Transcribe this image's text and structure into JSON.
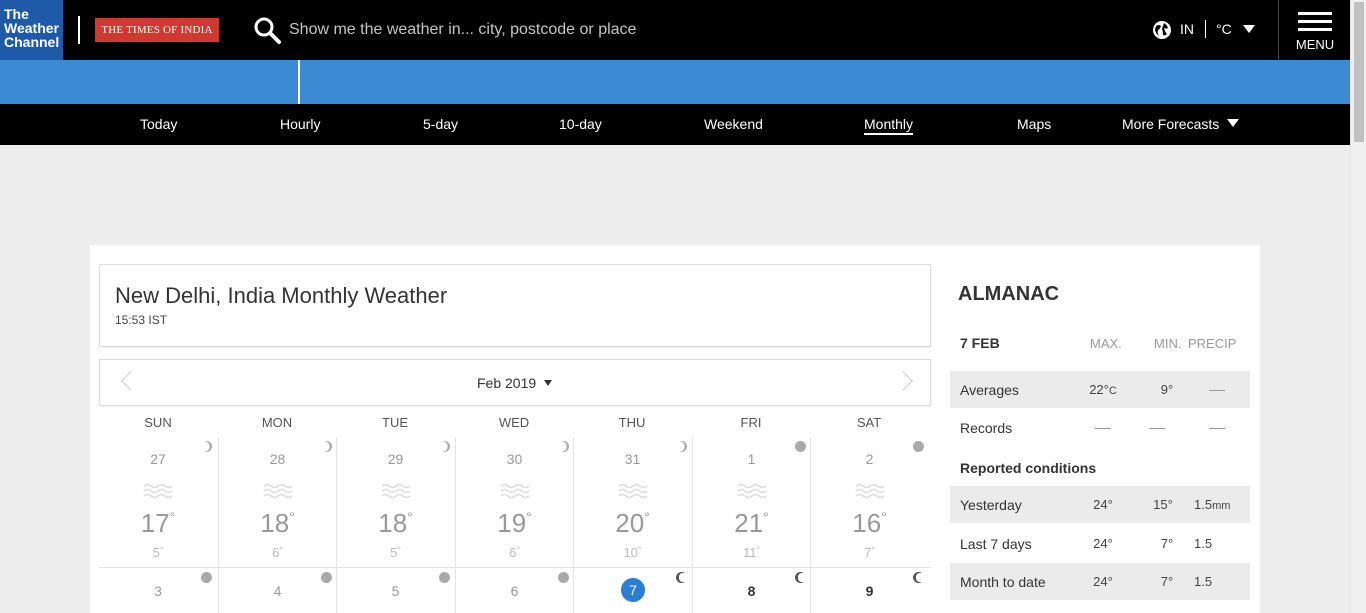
{
  "header": {
    "brand_lines": [
      "The",
      "Weather",
      "Channel"
    ],
    "partner_logo": "THE TIMES OF INDIA",
    "search_placeholder": "Show me the weather in... city, postcode or place",
    "region": "IN",
    "unit": "°C",
    "menu_label": "MENU"
  },
  "nav": {
    "items": [
      "Today",
      "Hourly",
      "5-day",
      "10-day",
      "Weekend",
      "Monthly",
      "Maps",
      "More Forecasts"
    ],
    "active": "Monthly"
  },
  "title": {
    "heading": "New Delhi, India Monthly Weather",
    "time": "15:53 IST"
  },
  "calendar": {
    "month_label": "Feb 2019",
    "weekdays": [
      "SUN",
      "MON",
      "TUE",
      "WED",
      "THU",
      "FRI",
      "SAT"
    ],
    "week1": [
      {
        "date": "27",
        "hi": "17",
        "lo": "5",
        "moon": "waning-crescent"
      },
      {
        "date": "28",
        "hi": "18",
        "lo": "6",
        "moon": "waning-crescent"
      },
      {
        "date": "29",
        "hi": "18",
        "lo": "5",
        "moon": "waning-crescent"
      },
      {
        "date": "30",
        "hi": "19",
        "lo": "6",
        "moon": "waning-crescent"
      },
      {
        "date": "31",
        "hi": "20",
        "lo": "10",
        "moon": "waning-crescent"
      },
      {
        "date": "1",
        "hi": "21",
        "lo": "11",
        "moon": "new"
      },
      {
        "date": "2",
        "hi": "16",
        "lo": "7",
        "moon": "new"
      }
    ],
    "week2": [
      {
        "date": "3",
        "moon": "new"
      },
      {
        "date": "4",
        "moon": "new"
      },
      {
        "date": "5",
        "moon": "new"
      },
      {
        "date": "6",
        "moon": "new"
      },
      {
        "date": "7",
        "moon": "waxing-crescent",
        "today": true
      },
      {
        "date": "8",
        "moon": "waxing-crescent"
      },
      {
        "date": "9",
        "moon": "waxing-crescent"
      }
    ]
  },
  "almanac": {
    "title": "ALMANAC",
    "date": "7 FEB",
    "col_max": "MAX.",
    "col_min": "MIN.",
    "col_precip": "PRECIP",
    "averages": {
      "label": "Averages",
      "max": "22°",
      "max_unit": "C",
      "min": "9°"
    },
    "records": {
      "label": "Records"
    },
    "reported_title": "Reported conditions",
    "yesterday": {
      "label": "Yesterday",
      "max": "24°",
      "min": "15°",
      "precip": "1.5",
      "precip_unit": "mm"
    },
    "last7": {
      "label": "Last 7 days",
      "max": "24°",
      "min": "7°",
      "precip": "1.5"
    },
    "mtd": {
      "label": "Month to date",
      "max": "24°",
      "min": "7°",
      "precip": "1.5"
    }
  },
  "colors": {
    "brand_blue": "#1e5aa8",
    "band_blue": "#3b8bd4",
    "toi_red": "#d0392f",
    "today_blue": "#2a7fd4"
  }
}
